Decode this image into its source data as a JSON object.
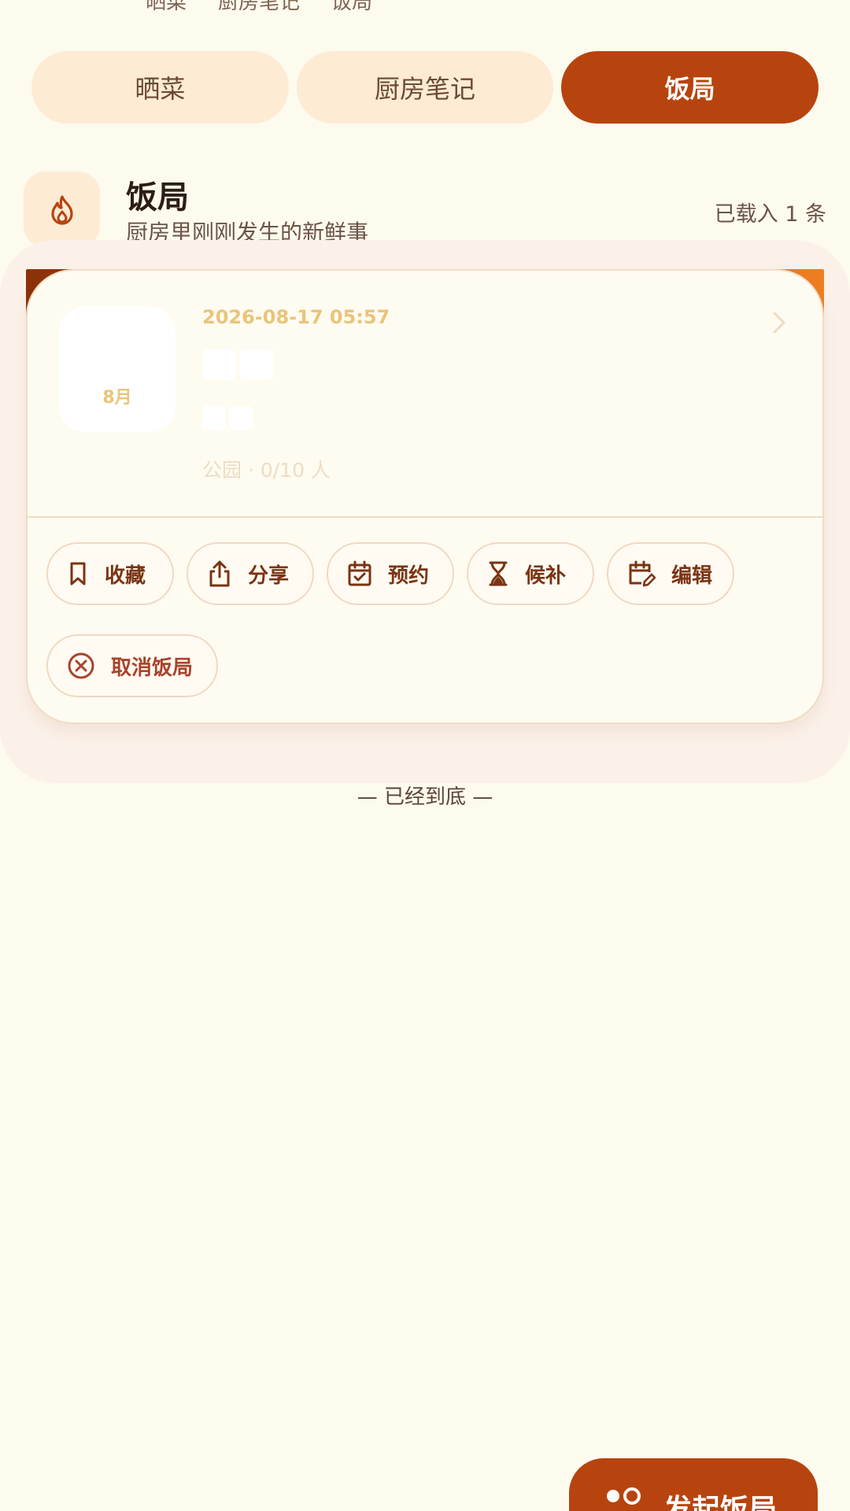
{
  "top_tabs_cut": [
    "晒菜",
    "厨房笔记",
    "饭局"
  ],
  "tabs": [
    {
      "label": "晒菜"
    },
    {
      "label": "厨房笔记"
    },
    {
      "label": "饭局"
    }
  ],
  "section": {
    "title": "饭局",
    "subtitle": "厨房里刚刚发生的新鲜事",
    "count_text": "已载入 1 条"
  },
  "event": {
    "month": "8月",
    "datetime": "2026-08-17 05:57",
    "meta": "公园 · 0/10 人"
  },
  "actions": {
    "favorite": "收藏",
    "share": "分享",
    "reserve": "预约",
    "waitlist": "候补",
    "edit": "编辑",
    "cancel": "取消饭局"
  },
  "list_end": "— 已经到底 —",
  "fab_label": "发起饭局",
  "colors": {
    "background": "#fdfaee",
    "accent": "#b7440e",
    "tab_inactive": "#fdebd4",
    "date_text": "#eac47a"
  }
}
